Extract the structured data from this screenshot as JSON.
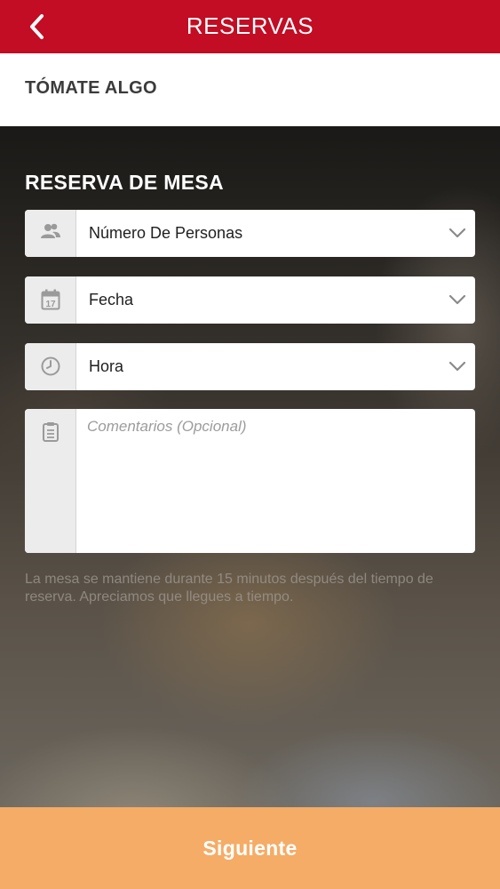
{
  "header": {
    "title": "RESERVAS",
    "back_icon": "chevron-left-icon"
  },
  "restaurant": {
    "name": "TÓMATE ALGO"
  },
  "form": {
    "title": "RESERVA DE MESA",
    "fields": [
      {
        "label": "Número De Personas",
        "icon": "people-icon"
      },
      {
        "label": "Fecha",
        "icon": "calendar-icon",
        "icon_text": "17"
      },
      {
        "label": "Hora",
        "icon": "clock-icon"
      }
    ],
    "comments": {
      "placeholder": "Comentarios (Opcional)",
      "value": "",
      "icon": "clipboard-icon"
    },
    "notice": "La mesa se mantiene durante 15 minutos después del tiempo de reserva. Apreciamos que llegues a tiempo."
  },
  "footer": {
    "next_label": "Siguiente"
  },
  "colors": {
    "header_red": "#c20d24",
    "next_orange": "#f5ac66",
    "icon_gray": "#9a9a9a"
  }
}
